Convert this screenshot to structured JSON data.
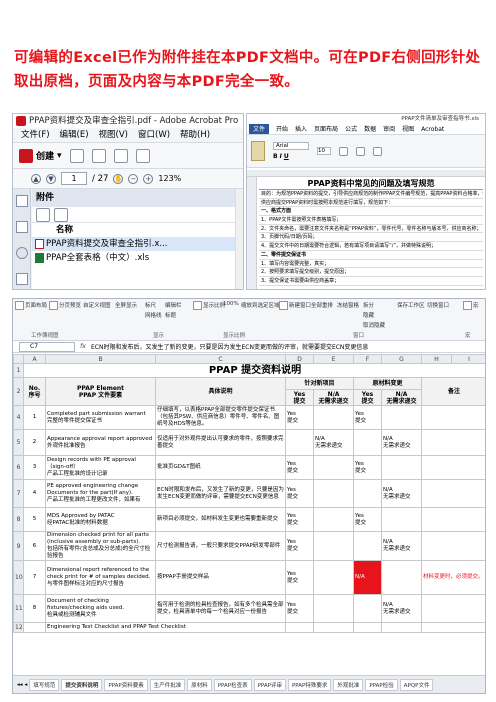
{
  "notice": "可编辑的Excel已作为附件挂在本PDF文档中。可在PDF右侧回形针处取出原档，页面及内容与本PDF完全一致。",
  "acrobat": {
    "title": "PPAP资料提交及审查全指引.pdf - Adobe Acrobat Pro",
    "menu": [
      "文件(F)",
      "编辑(E)",
      "视图(V)",
      "窗口(W)",
      "帮助(H)"
    ],
    "create_label": "创建",
    "page_current": "1",
    "page_total": "/ 27",
    "zoom": "123%",
    "attachments_label": "附件",
    "column_name": "名称",
    "files": [
      {
        "name": "PPAP资料提交及审查全指引.x...",
        "type": "pdf"
      },
      {
        "name": "PPAP全套表格（中文）.xls",
        "type": "xls"
      }
    ],
    "side_icons": [
      "page-thumbnail-icon",
      "bookmark-icon",
      "paperclip-icon",
      "signature-icon"
    ]
  },
  "excel_top": {
    "file_title": "PPAP文件清单及审查指导书.xls",
    "tabs": [
      "文件",
      "开始",
      "插入",
      "页面布局",
      "公式",
      "数据",
      "审阅",
      "视图",
      "Acrobat"
    ],
    "font_name": "Arial",
    "font_size": "10",
    "doc_title": "PPAP资料中常见的问题及填写规范",
    "lines": [
      "目的：为规范PPAP资料的提交，引导供应商规范的制作PPAP文件编号规范，提高PPAP资料合格率，特制",
      "供应商提交PPAP资料时需按照本规范进行填写，规范如下：",
      "一、格式方面",
      "1、PPAP文件需按照文件表格填写；",
      "2、文件夹命名，需要注意文件夹名称是“PPAP资料”，零件代号，零件名称与版本号，供应商名称；",
      "3、页脚代码/日期/页码；",
      "4、提交文件中的日期需要符合逻辑，若有填写项目请填写“/”，并做特殊说明；",
      "二、零件提交保证书",
      "1、填写内容需要完整，真实；",
      "2、按照要求填写提交级别，提交原因；",
      "3、提交保证书需要由供应商盖章；"
    ]
  },
  "excel_bottom": {
    "ribbon_groups": [
      "页面布局",
      "分页预览",
      "自定义视图",
      "全屏显示",
      "标尺",
      "网格线",
      "编辑栏",
      "标题",
      "显示比例",
      "100%",
      "缩放到选定区域",
      "新建窗口",
      "全部重排",
      "冻结窗格",
      "拆分",
      "隐藏",
      "取消隐藏",
      "保存工作区",
      "切换窗口",
      "宏"
    ],
    "ribbon_group_labels": [
      "工作簿视图",
      "显示",
      "显示比例",
      "窗口",
      "宏"
    ],
    "namebox": "C7",
    "formula": "ECN时限和发布后，又发生了新的变更，只要是因为发生ECN变更而做的评审，就需要提交ECN变更信息",
    "col_letters": [
      "A",
      "B",
      "C",
      "D",
      "E",
      "F",
      "G",
      "H",
      "I",
      "J"
    ],
    "table_title": "PPAP 提交资料说明",
    "headers": {
      "no": "No.\n序号",
      "element": "PPAP Element\nPPAP 文件要素",
      "explain": "具体说明",
      "review": "针对新项目",
      "material": "原材料变更",
      "remark": "备注",
      "yes": "Yes\n提交",
      "na": "N/A\n无需求递交"
    },
    "rows": [
      {
        "rownum": "4",
        "no": "1",
        "element": "Completed part submission warrant\n完整的零件提交保证书",
        "explain": "仔细填写，以表格PPAP全部提交零件提交保证书（包括其PSW、供应商信息）零件号、零件名、图纸号及HDS等信息。",
        "yes": "Yes\n提交",
        "na": "",
        "m_yes": "Yes\n提交",
        "m_na": "",
        "remark": "",
        "red": false
      },
      {
        "rownum": "5",
        "no": "2",
        "element": "Appearance approval report approved\n外观件批准报告",
        "explain": "仅适用于对外观件提出认可要求的零件，按照要求完善提交",
        "yes": "",
        "na": "N/A\n无需求递交",
        "m_yes": "",
        "m_na": "N/A\n无需求递交",
        "remark": "",
        "red": false
      },
      {
        "rownum": "6",
        "no": "3",
        "element": "Design records with  PE approval （sign-off）\n产品工程批准的设计记录",
        "explain": "批准页GD&T图纸",
        "yes": "Yes\n提交",
        "na": "",
        "m_yes": "Yes\n提交",
        "m_na": "",
        "remark": "",
        "red": false
      },
      {
        "rownum": "7",
        "no": "4",
        "element": "PE approved engineering change Documents for the part(If any).\n产品工程批准的工程更改文件，如果有",
        "explain": "ECN时限和发布后，又发生了新的变更，只要是因为发生ECN变更而做的评审，需要提交ECN变更信息",
        "yes": "Yes\n提交",
        "na": "",
        "m_yes": "",
        "m_na": "N/A\n无需求递交",
        "remark": "",
        "red": false
      },
      {
        "rownum": "8",
        "no": "5",
        "element": "MDS Approved by PATAC\n经PATAC批准的材料数据",
        "explain": "新项目必须提交，如材料发生变更也需要重新提交",
        "yes": "Yes\n提交",
        "na": "",
        "m_yes": "Yes\n提交",
        "m_na": "",
        "remark": "",
        "red": false
      },
      {
        "rownum": "9",
        "no": "6",
        "element": "Dimension checked print for all parts (inclusive assembly or sub-parts).\n包括所有零件(含总成及分总成)的全尺寸检验报告",
        "explain": "尺寸检测报告请，一般只要求提交PPAP研发零部件",
        "yes": "Yes\n提交",
        "na": "",
        "m_yes": "",
        "m_na": "N/A\n无需求递交",
        "remark": "",
        "red": false
      },
      {
        "rownum": "10",
        "no": "7",
        "element": "Dimensional report referenced to the check print for # of samples decided.\n与零件图样标注对应的尺寸报告",
        "explain": "按PPAP手册提交样品",
        "yes": "Yes\n提交",
        "na": "",
        "m_yes": "N/A",
        "m_na": "",
        "remark": "材料变更时，必须提交。",
        "red": true
      },
      {
        "rownum": "11",
        "no": "8",
        "element": "Document of checking fixtures/checking aids used.\n检具或检测辅具文件",
        "explain": "指可用于检测的检具检查报告，如有多个检具需全部提交，检具清单中的每一个检具对应一份报告",
        "yes": "Yes\n提交",
        "na": "",
        "m_yes": "",
        "m_na": "N/A\n无需求递交",
        "remark": "",
        "red": false
      },
      {
        "rownum": "12",
        "no": "",
        "element": "Engineering Test Checklist and PPAP Test Checklist",
        "explain": "",
        "yes": "",
        "na": "",
        "m_yes": "",
        "m_na": "",
        "remark": "",
        "red": false
      }
    ],
    "sheet_tabs": [
      "填写规范",
      "提交资料说明",
      "PPAP资料要素",
      "生产件批准",
      "原材料",
      "PPAP检查表",
      "PPAP评审",
      "PPAP特殊要求",
      "外观批准",
      "PPAP检验",
      "APQP文件"
    ]
  }
}
